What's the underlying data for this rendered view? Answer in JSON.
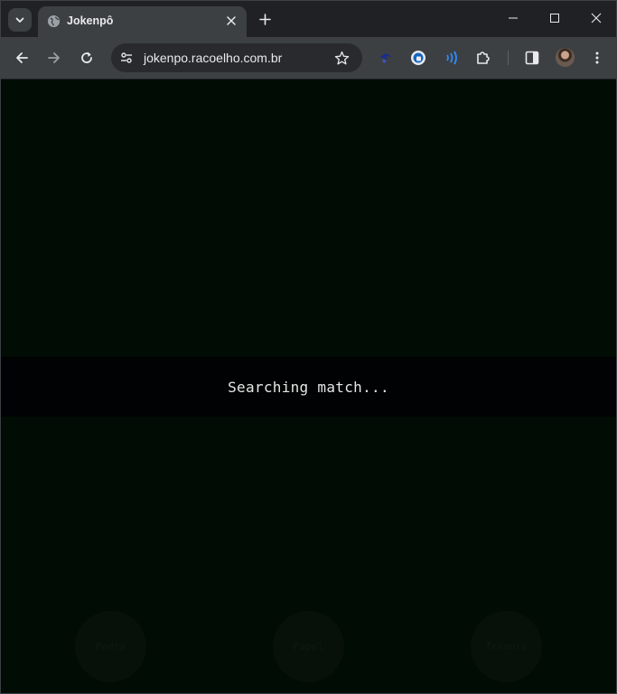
{
  "browser": {
    "tab": {
      "title": "Jokenpô",
      "favicon": "globe-icon"
    },
    "url": "jokenpo.racoelho.com.br",
    "extensions": [
      "bird-extension-icon",
      "password-manager-icon",
      "audio-waves-icon",
      "puzzle-icon"
    ],
    "colors": {
      "tabstrip": "#202124",
      "toolbar": "#3c4043",
      "omnibox": "#282a2d"
    }
  },
  "page": {
    "status_text": "Searching match...",
    "choices": [
      {
        "label": "Pedra"
      },
      {
        "label": "Papel"
      },
      {
        "label": "Tesoura"
      }
    ],
    "colors": {
      "background": "#010c04",
      "banner": "#000203",
      "text": "#e6e6e6"
    }
  }
}
